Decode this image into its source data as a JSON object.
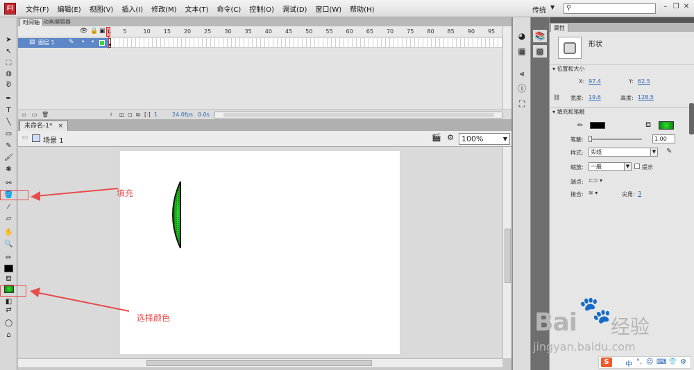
{
  "app": {
    "logo": "Fl"
  },
  "menu": [
    "文件(F)",
    "编辑(E)",
    "视图(V)",
    "插入(I)",
    "修改(M)",
    "文本(T)",
    "命令(C)",
    "控制(O)",
    "调试(D)",
    "窗口(W)",
    "帮助(H)"
  ],
  "workspace": {
    "label": "传统"
  },
  "timeline": {
    "tabs": [
      "时间轴",
      "动画编辑器"
    ],
    "frame_numbers": [
      "1",
      "5",
      "10",
      "15",
      "20",
      "25",
      "30",
      "35",
      "40",
      "45",
      "50",
      "55",
      "60",
      "65",
      "70",
      "75",
      "80",
      "85",
      "90",
      "95"
    ],
    "layer_name": "图层 1",
    "current_frame": "1",
    "fps": "24.0fps",
    "time": "0.0s"
  },
  "document": {
    "tab_title": "未命名-1*",
    "tab_close": "×",
    "scene": "场景 1",
    "zoom": "100%"
  },
  "annotations": {
    "fill": "填充",
    "choose_color": "选择颜色"
  },
  "properties": {
    "tab": "属性",
    "object_type": "形状",
    "section_position": "位置和大小",
    "x_label": "X:",
    "x_value": "97.4",
    "y_label": "Y:",
    "y_value": "62.5",
    "width_label": "宽度:",
    "width_value": "19.6",
    "height_label": "高度:",
    "height_value": "128.5",
    "section_fill_stroke": "填充和笔触",
    "stroke_label": "笔触:",
    "stroke_value": "1.00",
    "style_label": "样式:",
    "style_value": "实线",
    "scale_label": "缩放:",
    "scale_value": "一般",
    "hint_label": "提示",
    "cap_label": "端点:",
    "join_label": "接合:",
    "miter_label": "尖角:",
    "miter_value": "3"
  },
  "colors": {
    "stroke": "#000000",
    "fill_gradient_center": "#2ee02e",
    "fill_gradient_edge": "#0a7a0a",
    "annotation": "#e74c4c",
    "layer_highlight": "#5d87c6"
  },
  "watermark": {
    "brand": "Bai",
    "brand2": "经验",
    "url": "jingyan.baidu.com"
  },
  "ime": {
    "logo": "S",
    "items": [
      "中",
      "°,",
      "☺",
      "⌨",
      "👕",
      "⚙"
    ]
  }
}
